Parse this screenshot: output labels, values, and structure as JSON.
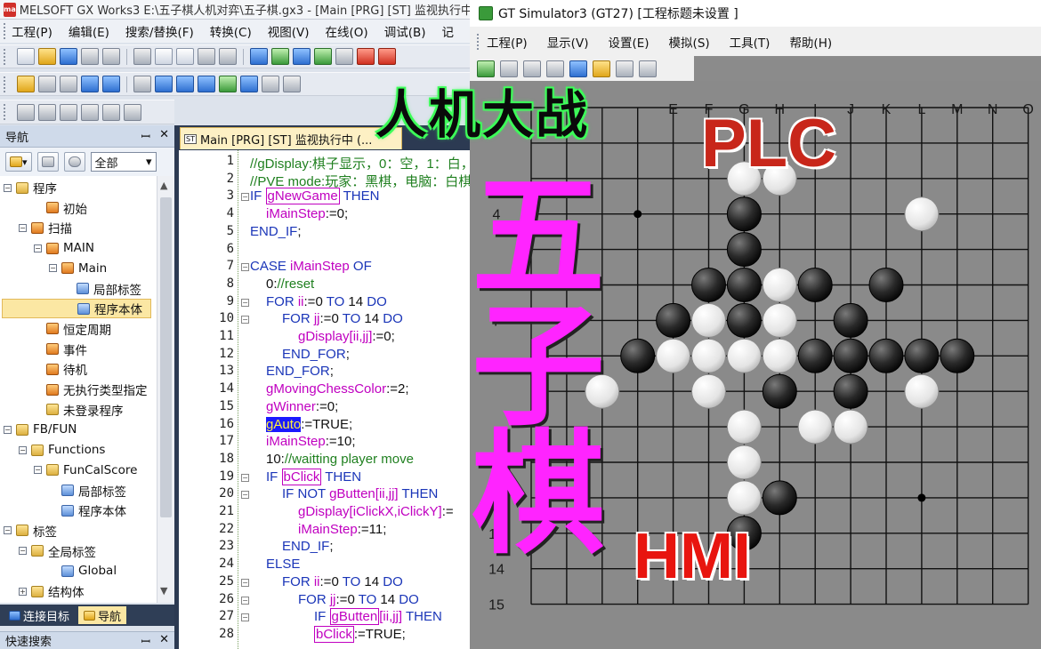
{
  "gx": {
    "title": "MELSOFT GX Works3 E:\\五子棋人机对弈\\五子棋.gx3 - [Main [PRG] [ST] 监视执行中",
    "logo_text": "ma",
    "menu": [
      "工程(P)",
      "编辑(E)",
      "搜索/替换(F)",
      "转换(C)",
      "视图(V)",
      "在线(O)",
      "调试(B)",
      "记"
    ],
    "nav": {
      "title": "导航",
      "pin": "ꟷ",
      "close": "✕",
      "scope_value": "全部",
      "tree": [
        {
          "label": "程序",
          "level": 0,
          "exp": "−",
          "icon": "folder"
        },
        {
          "label": "初始",
          "level": 2,
          "exp": "",
          "icon": "prog"
        },
        {
          "label": "扫描",
          "level": 1,
          "exp": "−",
          "icon": "prog"
        },
        {
          "label": "MAIN",
          "level": 2,
          "exp": "−",
          "icon": "prog"
        },
        {
          "label": "Main",
          "level": 3,
          "exp": "−",
          "icon": "prog"
        },
        {
          "label": "局部标签",
          "level": 4,
          "exp": "",
          "icon": "label"
        },
        {
          "label": "程序本体",
          "level": 4,
          "exp": "",
          "icon": "label",
          "selected": true
        },
        {
          "label": "恒定周期",
          "level": 2,
          "exp": "",
          "icon": "prog"
        },
        {
          "label": "事件",
          "level": 2,
          "exp": "",
          "icon": "prog"
        },
        {
          "label": "待机",
          "level": 2,
          "exp": "",
          "icon": "prog"
        },
        {
          "label": "无执行类型指定",
          "level": 2,
          "exp": "",
          "icon": "prog"
        },
        {
          "label": "未登录程序",
          "level": 2,
          "exp": "",
          "icon": "folder"
        },
        {
          "label": "FB/FUN",
          "level": 0,
          "exp": "−",
          "icon": "folder"
        },
        {
          "label": "Functions",
          "level": 1,
          "exp": "−",
          "icon": "folder"
        },
        {
          "label": "FunCalScore",
          "level": 2,
          "exp": "−",
          "icon": "folder"
        },
        {
          "label": "局部标签",
          "level": 3,
          "exp": "",
          "icon": "label"
        },
        {
          "label": "程序本体",
          "level": 3,
          "exp": "",
          "icon": "label"
        },
        {
          "label": "标签",
          "level": 0,
          "exp": "−",
          "icon": "folder"
        },
        {
          "label": "全局标签",
          "level": 1,
          "exp": "−",
          "icon": "folder"
        },
        {
          "label": "Global",
          "level": 3,
          "exp": "",
          "icon": "label"
        },
        {
          "label": "结构体",
          "level": 1,
          "exp": "+",
          "icon": "folder"
        }
      ],
      "tabs": [
        "连接目标",
        "导航"
      ],
      "quick_search": "快速搜索"
    },
    "editor_tab": "Main [PRG] [ST] 监视执行中 (...",
    "st_badge": "ST",
    "lines": [
      {
        "n": "1",
        "indent": 0,
        "html": "<span class='cmt'>//gDisplay:棋子显示，0：空，1：白，</span>"
      },
      {
        "n": "2",
        "indent": 0,
        "html": "<span class='cmt'>//PVE mode:玩家：黑棋，电脑：白棋，</span>"
      },
      {
        "n": "3",
        "indent": 0,
        "fold": "−",
        "html": "<span class='kw'>IF</span> <span class='var boxed'>gNewGame</span> <span class='kw'>THEN</span>"
      },
      {
        "n": "4",
        "indent": 1,
        "html": "<span class='var'>iMainStep</span>:=0;"
      },
      {
        "n": "5",
        "indent": 0,
        "html": "<span class='kw'>END_IF</span>;"
      },
      {
        "n": "6",
        "indent": 0,
        "html": ""
      },
      {
        "n": "7",
        "indent": 0,
        "fold": "−",
        "html": "<span class='kw'>CASE</span> <span class='var'>iMainStep</span> <span class='kw'>OF</span>"
      },
      {
        "n": "8",
        "indent": 1,
        "html": "0:<span class='cmt'>//reset</span>"
      },
      {
        "n": "9",
        "indent": 1,
        "fold": "−",
        "html": "<span class='kw'>FOR</span> <span class='var'>ii</span>:=0 <span class='kw'>TO</span> 14 <span class='kw'>DO</span>"
      },
      {
        "n": "10",
        "indent": 2,
        "fold": "−",
        "html": "<span class='kw'>FOR</span> <span class='var'>jj</span>:=0 <span class='kw'>TO</span> 14 <span class='kw'>DO</span>"
      },
      {
        "n": "11",
        "indent": 3,
        "html": "<span class='var'>gDisplay[ii,jj]</span>:=0;"
      },
      {
        "n": "12",
        "indent": 2,
        "html": "<span class='kw'>END_FOR</span>;"
      },
      {
        "n": "13",
        "indent": 1,
        "html": "<span class='kw'>END_FOR</span>;"
      },
      {
        "n": "14",
        "indent": 1,
        "html": "<span class='var'>gMovingChessColor</span>:=2;"
      },
      {
        "n": "15",
        "indent": 1,
        "html": "<span class='var'>gWinner</span>:=0;"
      },
      {
        "n": "16",
        "indent": 1,
        "html": "<span class='hl'>gAuto</span>:=TRUE;"
      },
      {
        "n": "17",
        "indent": 1,
        "html": "<span class='var'>iMainStep</span>:=10;"
      },
      {
        "n": "18",
        "indent": 1,
        "html": "10:<span class='cmt'>//waitting player move</span>"
      },
      {
        "n": "19",
        "indent": 1,
        "fold": "−",
        "html": "<span class='kw'>IF</span> <span class='var boxed'>bClick</span> <span class='kw'>THEN</span>"
      },
      {
        "n": "20",
        "indent": 2,
        "fold": "−",
        "html": "<span class='kw'>IF NOT</span> <span class='var'>gButten[ii,jj]</span> <span class='kw'>THEN</span>"
      },
      {
        "n": "21",
        "indent": 3,
        "html": "<span class='var'>gDisplay[iClickX,iClickY]</span>:="
      },
      {
        "n": "22",
        "indent": 3,
        "html": "<span class='var'>iMainStep</span>:=11;"
      },
      {
        "n": "23",
        "indent": 2,
        "html": "<span class='kw'>END_IF</span>;"
      },
      {
        "n": "24",
        "indent": 1,
        "html": "<span class='kw'>ELSE</span>"
      },
      {
        "n": "25",
        "indent": 2,
        "fold": "−",
        "html": "<span class='kw'>FOR</span> <span class='var'>ii</span>:=0 <span class='kw'>TO</span> 14 <span class='kw'>DO</span>"
      },
      {
        "n": "26",
        "indent": 3,
        "fold": "−",
        "html": "<span class='kw'>FOR</span> <span class='var'>jj</span>:=0 <span class='kw'>TO</span> 14 <span class='kw'>DO</span>"
      },
      {
        "n": "27",
        "indent": 4,
        "fold": "−",
        "html": "<span class='kw'>IF</span> <span class='var boxed'>gButten</span><span class='var'>[ii,jj]</span> <span class='kw'>THEN</span>"
      },
      {
        "n": "28",
        "indent": 4,
        "html": "<span class='var boxed'>bClick</span>:=TRUE;"
      }
    ]
  },
  "gt": {
    "title": "GT Simulator3 (GT27)  [工程标题未设置 ]",
    "menu": [
      "工程(P)",
      "显示(V)",
      "设置(E)",
      "模拟(S)",
      "工具(T)",
      "帮助(H)"
    ],
    "board": {
      "columns": [
        "E",
        "F",
        "G",
        "H",
        "I",
        "J",
        "K",
        "L",
        "M",
        "N",
        "O"
      ],
      "rows": [
        "4",
        "7",
        "13",
        "14",
        "15"
      ],
      "size": 15,
      "stones_black": [
        [
          6,
          4
        ],
        [
          6,
          5
        ],
        [
          5,
          6
        ],
        [
          6,
          6
        ],
        [
          8,
          6
        ],
        [
          10,
          6
        ],
        [
          4,
          7
        ],
        [
          6,
          7
        ],
        [
          9,
          7
        ],
        [
          3,
          8
        ],
        [
          8,
          8
        ],
        [
          9,
          8
        ],
        [
          10,
          8
        ],
        [
          11,
          8
        ],
        [
          12,
          8
        ],
        [
          7,
          9
        ],
        [
          9,
          9
        ],
        [
          7,
          12
        ],
        [
          6,
          13
        ]
      ],
      "stones_white": [
        [
          6,
          3
        ],
        [
          7,
          3
        ],
        [
          11,
          4
        ],
        [
          7,
          6
        ],
        [
          5,
          7
        ],
        [
          7,
          7
        ],
        [
          4,
          8
        ],
        [
          5,
          8
        ],
        [
          6,
          8
        ],
        [
          7,
          8
        ],
        [
          2,
          9
        ],
        [
          5,
          9
        ],
        [
          11,
          9
        ],
        [
          6,
          10
        ],
        [
          8,
          10
        ],
        [
          9,
          10
        ],
        [
          6,
          11
        ],
        [
          6,
          12
        ]
      ],
      "star_points": [
        [
          3,
          4
        ],
        [
          11,
          12
        ]
      ]
    }
  },
  "overlay": {
    "battle": "人机大战",
    "plc": "PLC",
    "gomoku_1": "五",
    "gomoku_2": "子",
    "gomoku_3": "棋",
    "hmi": "HMI"
  },
  "colors": {
    "keyword": "#1a35b8",
    "variable": "#c000c0",
    "comment": "#208020",
    "board_bg": "#8a8a8a",
    "overlay_magenta": "#ff24ff",
    "overlay_red": "#e8150f"
  }
}
